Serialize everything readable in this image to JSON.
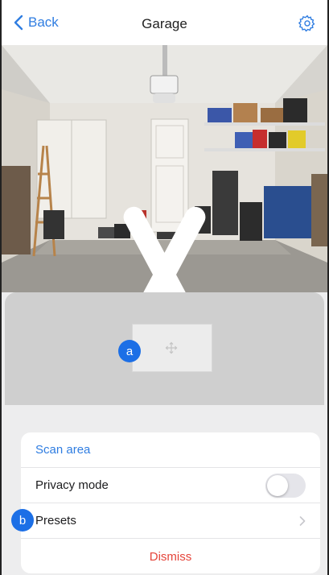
{
  "nav": {
    "back_label": "Back",
    "title": "Garage",
    "settings_icon": "gear-icon",
    "back_icon": "chevron-left-icon"
  },
  "camera": {
    "left_arrow_icon": "chevron-left-icon",
    "right_arrow_icon": "chevron-right-icon"
  },
  "scan_area": {
    "move_icon": "move-icon"
  },
  "markers": {
    "a": "a",
    "b": "b"
  },
  "menu": {
    "scan_area_label": "Scan area",
    "privacy_mode_label": "Privacy mode",
    "privacy_mode_on": false,
    "presets_label": "Presets",
    "dismiss_label": "Dismiss"
  },
  "colors": {
    "accent": "#2f7de1",
    "marker": "#1c6fe6",
    "destructive": "#e5453b"
  }
}
